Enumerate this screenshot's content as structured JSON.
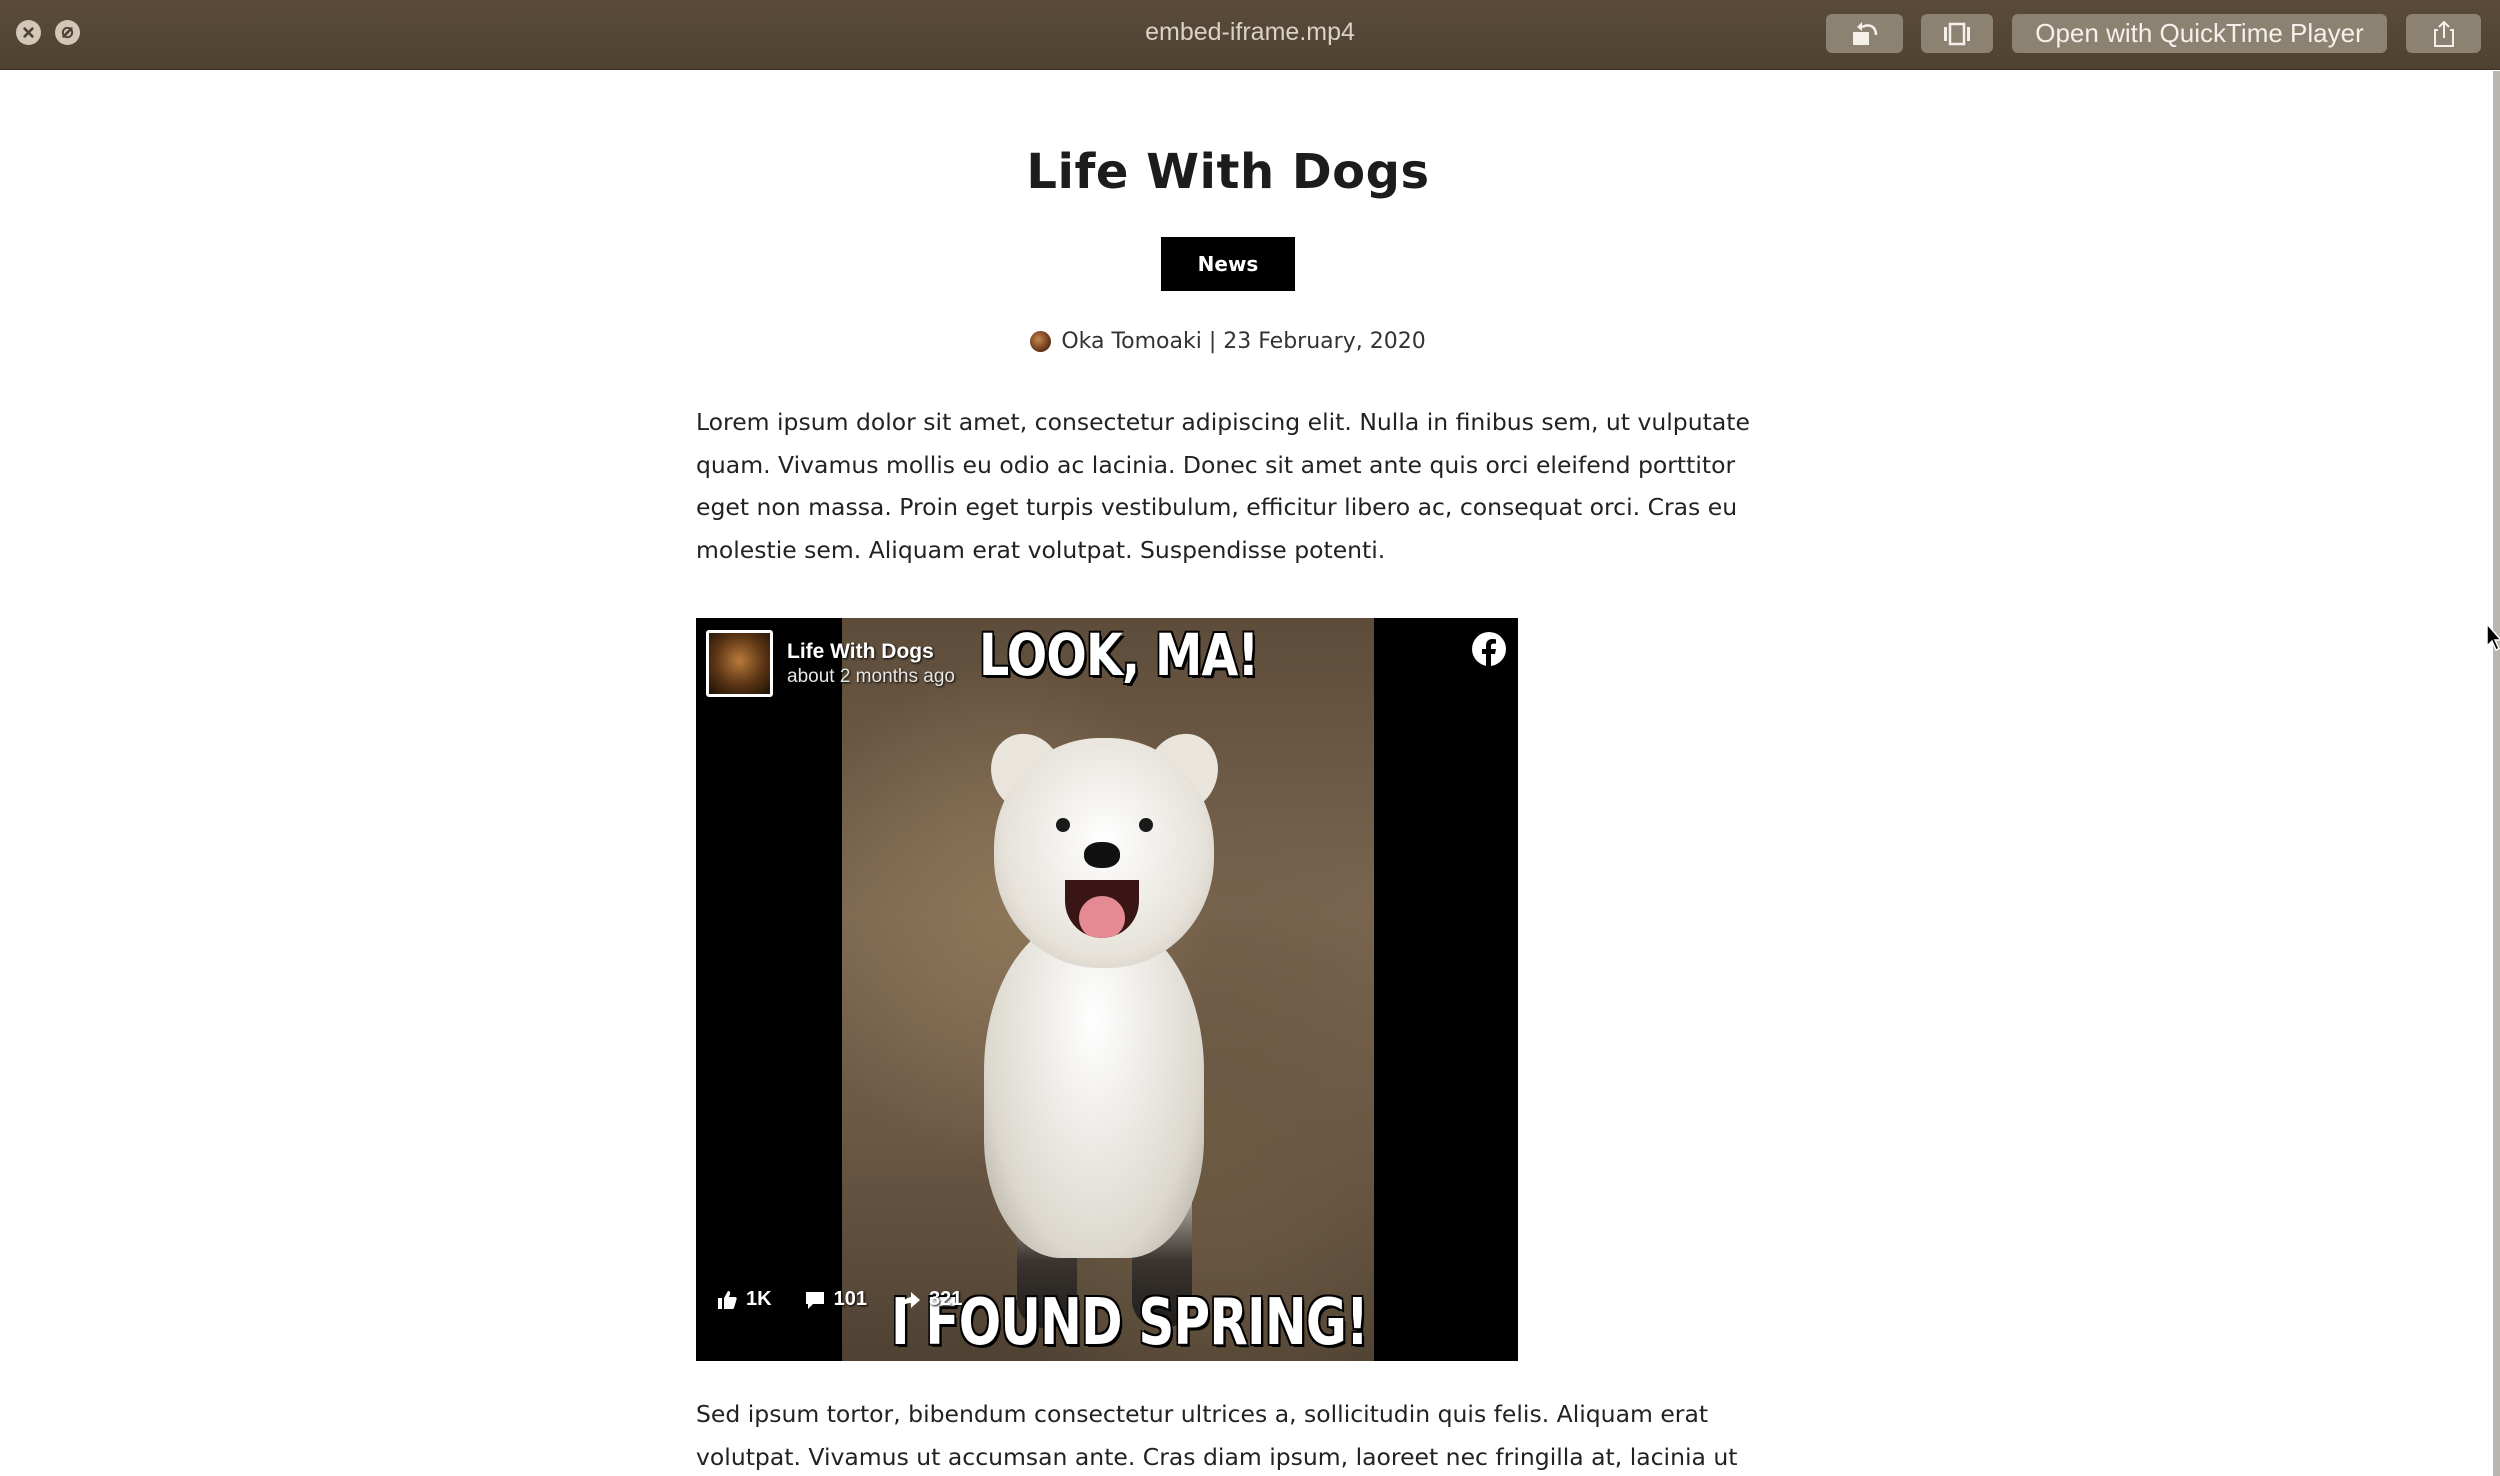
{
  "window": {
    "title": "embed-iframe.mp4",
    "open_with_label": "Open with QuickTime Player"
  },
  "toolbar_icons": [
    "close-icon",
    "fullscreen-icon",
    "rotate-icon",
    "trim-icon",
    "share-icon"
  ],
  "article": {
    "title": "Life With Dogs",
    "category": "News",
    "byline": "Oka Tomoaki | 23 February, 2020",
    "paragraph1": "Lorem ipsum dolor sit amet, consectetur adipiscing elit. Nulla in finibus sem, ut vulputate quam. Vivamus mollis eu odio ac lacinia. Donec sit amet ante quis orci eleifend porttitor eget non massa. Proin eget turpis vestibulum, efficitur libero ac, consequat orci. Cras eu molestie sem. Aliquam erat volutpat. Suspendisse potenti.",
    "paragraph2": "Sed ipsum tortor, bibendum consectetur ultrices a, sollicitudin quis felis. Aliquam erat volutpat. Vivamus ut accumsan ante. Cras diam ipsum, laoreet nec fringilla at, lacinia ut"
  },
  "embed": {
    "page_name": "Life With Dogs",
    "posted": "about 2 months ago",
    "meme_top": "LOOK, MA!",
    "meme_bottom": "I FOUND SPRING!",
    "likes": "1K",
    "comments": "101",
    "shares": "321"
  }
}
